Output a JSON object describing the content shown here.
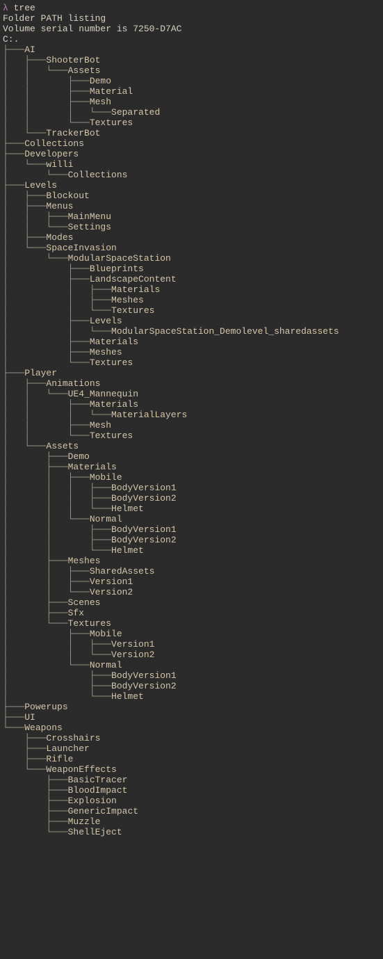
{
  "prompt": {
    "symbol": "λ",
    "command": "tree"
  },
  "header": {
    "line1": "Folder PATH listing",
    "line2": "Volume serial number is 7250-D7AC",
    "root": "C:."
  },
  "tree": [
    {
      "p": "├───",
      "n": "AI"
    },
    {
      "p": "│   ├───",
      "n": "ShooterBot"
    },
    {
      "p": "│   │   └───",
      "n": "Assets"
    },
    {
      "p": "│   │       ├───",
      "n": "Demo"
    },
    {
      "p": "│   │       ├───",
      "n": "Material"
    },
    {
      "p": "│   │       ├───",
      "n": "Mesh"
    },
    {
      "p": "│   │       │   └───",
      "n": "Separated"
    },
    {
      "p": "│   │       └───",
      "n": "Textures"
    },
    {
      "p": "│   └───",
      "n": "TrackerBot"
    },
    {
      "p": "├───",
      "n": "Collections"
    },
    {
      "p": "├───",
      "n": "Developers"
    },
    {
      "p": "│   └───",
      "n": "willi"
    },
    {
      "p": "│       └───",
      "n": "Collections"
    },
    {
      "p": "├───",
      "n": "Levels"
    },
    {
      "p": "│   ├───",
      "n": "Blockout"
    },
    {
      "p": "│   ├───",
      "n": "Menus"
    },
    {
      "p": "│   │   ├───",
      "n": "MainMenu"
    },
    {
      "p": "│   │   └───",
      "n": "Settings"
    },
    {
      "p": "│   ├───",
      "n": "Modes"
    },
    {
      "p": "│   └───",
      "n": "SpaceInvasion"
    },
    {
      "p": "│       └───",
      "n": "ModularSpaceStation"
    },
    {
      "p": "│           ├───",
      "n": "Blueprints"
    },
    {
      "p": "│           ├───",
      "n": "LandscapeContent"
    },
    {
      "p": "│           │   ├───",
      "n": "Materials"
    },
    {
      "p": "│           │   ├───",
      "n": "Meshes"
    },
    {
      "p": "│           │   └───",
      "n": "Textures"
    },
    {
      "p": "│           ├───",
      "n": "Levels"
    },
    {
      "p": "│           │   └───",
      "n": "ModularSpaceStation_Demolevel_sharedassets"
    },
    {
      "p": "│           ├───",
      "n": "Materials"
    },
    {
      "p": "│           ├───",
      "n": "Meshes"
    },
    {
      "p": "│           └───",
      "n": "Textures"
    },
    {
      "p": "├───",
      "n": "Player"
    },
    {
      "p": "│   ├───",
      "n": "Animations"
    },
    {
      "p": "│   │   └───",
      "n": "UE4_Mannequin"
    },
    {
      "p": "│   │       ├───",
      "n": "Materials"
    },
    {
      "p": "│   │       │   └───",
      "n": "MaterialLayers"
    },
    {
      "p": "│   │       ├───",
      "n": "Mesh"
    },
    {
      "p": "│   │       └───",
      "n": "Textures"
    },
    {
      "p": "│   └───",
      "n": "Assets"
    },
    {
      "p": "│       ├───",
      "n": "Demo"
    },
    {
      "p": "│       ├───",
      "n": "Materials"
    },
    {
      "p": "│       │   ├───",
      "n": "Mobile"
    },
    {
      "p": "│       │   │   ├───",
      "n": "BodyVersion1"
    },
    {
      "p": "│       │   │   ├───",
      "n": "BodyVersion2"
    },
    {
      "p": "│       │   │   └───",
      "n": "Helmet"
    },
    {
      "p": "│       │   └───",
      "n": "Normal"
    },
    {
      "p": "│       │       ├───",
      "n": "BodyVersion1"
    },
    {
      "p": "│       │       ├───",
      "n": "BodyVersion2"
    },
    {
      "p": "│       │       └───",
      "n": "Helmet"
    },
    {
      "p": "│       ├───",
      "n": "Meshes"
    },
    {
      "p": "│       │   ├───",
      "n": "SharedAssets"
    },
    {
      "p": "│       │   ├───",
      "n": "Version1"
    },
    {
      "p": "│       │   └───",
      "n": "Version2"
    },
    {
      "p": "│       ├───",
      "n": "Scenes"
    },
    {
      "p": "│       ├───",
      "n": "Sfx"
    },
    {
      "p": "│       └───",
      "n": "Textures"
    },
    {
      "p": "│           ├───",
      "n": "Mobile"
    },
    {
      "p": "│           │   ├───",
      "n": "Version1"
    },
    {
      "p": "│           │   └───",
      "n": "Version2"
    },
    {
      "p": "│           └───",
      "n": "Normal"
    },
    {
      "p": "│               ├───",
      "n": "BodyVersion1"
    },
    {
      "p": "│               ├───",
      "n": "BodyVersion2"
    },
    {
      "p": "│               └───",
      "n": "Helmet"
    },
    {
      "p": "├───",
      "n": "Powerups"
    },
    {
      "p": "├───",
      "n": "UI"
    },
    {
      "p": "└───",
      "n": "Weapons"
    },
    {
      "p": "    ├───",
      "n": "Crosshairs"
    },
    {
      "p": "    ├───",
      "n": "Launcher"
    },
    {
      "p": "    ├───",
      "n": "Rifle"
    },
    {
      "p": "    └───",
      "n": "WeaponEffects"
    },
    {
      "p": "        ├───",
      "n": "BasicTracer"
    },
    {
      "p": "        ├───",
      "n": "BloodImpact"
    },
    {
      "p": "        ├───",
      "n": "Explosion"
    },
    {
      "p": "        ├───",
      "n": "GenericImpact"
    },
    {
      "p": "        ├───",
      "n": "Muzzle"
    },
    {
      "p": "        └───",
      "n": "ShellEject"
    }
  ]
}
